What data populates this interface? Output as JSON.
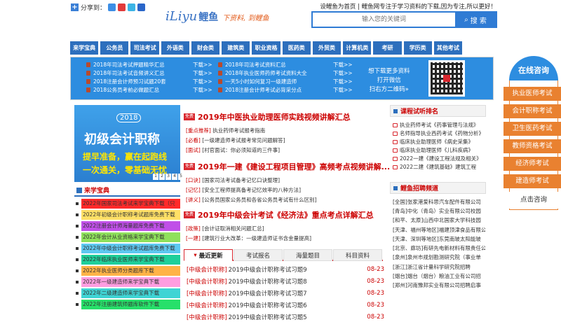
{
  "share": {
    "label": "分享到："
  },
  "toplinks": "设鲤鱼为首页 | 鲤鱼网专注于学习资料的下载,因为专注,所以更好！",
  "logo": {
    "en": "iLiyu",
    "cn": "鲤鱼",
    "slogan": "下资料, 到鲤鱼"
  },
  "search": {
    "placeholder": "输入您的关键词",
    "button": "搜 索"
  },
  "nav": [
    "来学宝典",
    "公务员",
    "司法考试",
    "外语类",
    "财会类",
    "建筑类",
    "职业资格",
    "医药类",
    "外贸类",
    "计算机类",
    "考研",
    "学历类",
    "其他考试"
  ],
  "banner": {
    "col1": [
      "2018年司法考试押题精华汇总",
      "2018年司法考试音频讲义汇总",
      "2018注册会计师预习试题20套",
      "2018公务员考前必做题汇总"
    ],
    "col2": [
      "2018年司法考试资料汇总",
      "2018年执业医师药师考试资料大全",
      "一天5小时如何复习一级建造师",
      "2018注册会计师考试必背采分点"
    ],
    "download": "下载>>",
    "right": [
      "想下载更多资料",
      "打开微信",
      "扫右方二维码"
    ],
    "right_arrow": "»"
  },
  "promo": {
    "year": "2018",
    "title": "初级会计职称",
    "line1": "提早准备，赢在起跑线",
    "line2": "一次通关，零基础无忧",
    "nums": [
      "1",
      "2",
      "3",
      "4",
      "5"
    ]
  },
  "left": {
    "heading": "来学宝典",
    "items": [
      {
        "text": "2022年国家司法考试来学宝典下载（只",
        "bg": "#ff2a2a"
      },
      {
        "text": "2022年初级会计职称考试题库免费下载",
        "bg": "#ffe066"
      },
      {
        "text": "2022注册会计师海量题库免费下载",
        "bg": "#c050e8"
      },
      {
        "text": "2022年会计从业资格来学宝典下载",
        "bg": "#8fe05c"
      },
      {
        "text": "2022年中级会计职称考试题库免费下载",
        "bg": "#5ec8f0"
      },
      {
        "text": "2022年临床执业医师来学宝典下载",
        "bg": "#1ecf9a"
      },
      {
        "text": "2022年执业医师分类题库下载",
        "bg": "#ffb347"
      },
      {
        "text": "2022年一级建造师来学宝典下载",
        "bg": "#ff9de0"
      },
      {
        "text": "2022年二级建造师来学宝典下载",
        "bg": "#3fd4d4"
      },
      {
        "text": "2022年注册建筑师题库软件下载",
        "bg": "#27e06a"
      }
    ]
  },
  "middle": {
    "mark": "免费",
    "h1": "2019年中医执业助理医师实践视频讲解汇总",
    "s1": [
      {
        "k": "[重点推荐]",
        "t": "执业药师考试报考指南"
      },
      {
        "k": "[必看]",
        "t": "[一级建造师考试报考常见问题解答]"
      },
      {
        "k": "[面试]",
        "t": "[村官面试：你必须知道的三件事]"
      }
    ],
    "h2": "2019年一建《建设工程项目管理》高频考点视频讲解...",
    "s2": [
      {
        "k": "[口诀]",
        "t": "[国家司法考试备考记忆口诀整理]"
      },
      {
        "k": "[记忆]",
        "t": "[安全工程师提高备考记忆效率的八种方法]"
      },
      {
        "k": "[讲义]",
        "t": "[公务员国家公务员和各省公务员考试有什么区别]"
      }
    ],
    "h3": "2019年中级会计考试《经济法》重点考点详解汇总",
    "s3": [
      {
        "k": "[政策]",
        "t": "[会计证取消相关问题汇总]"
      },
      {
        "k": "[一建]",
        "t": "[建筑行业大改革：一级建造师证书含金量提高]"
      }
    ],
    "tabs": [
      "最近更新",
      "考试报名",
      "海量题目",
      "科目资料"
    ],
    "news": [
      {
        "cat": "[中级会计职称]",
        "title": "2019中级会计职称考试习题9",
        "date": "08-23"
      },
      {
        "cat": "[中级会计职称]",
        "title": "2019中级会计职称考试习题8",
        "date": "08-23"
      },
      {
        "cat": "[中级会计职称]",
        "title": "2019中级会计职称考试习题7",
        "date": "08-23"
      },
      {
        "cat": "[中级会计职称]",
        "title": "2019中级会计职称考试习题6",
        "date": "08-23"
      },
      {
        "cat": "[中级会计职称]",
        "title": "2019中级会计职称考试习题5",
        "date": "08-23"
      }
    ]
  },
  "right": {
    "rank_heading": "课程试听排名",
    "rank": [
      "执业药师考试《药事管理与法规》",
      "名师指导执业西药考试《药物分析》",
      "临床执业助理医师《病史采集》",
      "临床执业助理医师《儿科疾病》",
      "2022一建《建设工程法规及相关》",
      "2022二建《建筑基础》建筑工程"
    ],
    "jobs_heading": "鲤鱼招聘频道",
    "jobs": [
      "[全国]张家港爱科思汽车配件有限公司",
      "[青岛]中化（青岛）实业有限公司校园",
      "[和平、太原]山西中北国家大学科技园",
      "[天津、福州等地区]福建顶津食品有限公",
      "[天津、深圳等地区]东莞南玻太阳能玻",
      "[北京、廊坊]有研先电新材料有限责任公",
      "[泉州]泉州市规划勘测研究院（事业单",
      "[浙江]浙江省计量科学研究院招聘",
      "[烟台]烟台（烟台）粮油工业有公司招",
      "[郑州]河南豫邦实业有限公司招聘启事"
    ]
  },
  "consult": {
    "title": "在线咨询",
    "items": [
      "执业医师考试",
      "会计职称考试",
      "卫生医药考试",
      "教师资格考试",
      "经济师考试",
      "建造师考试"
    ],
    "last": "点击咨询"
  },
  "colors": {
    "blue": "#2d6fbd",
    "red": "#c00",
    "orange": "#e98130"
  }
}
